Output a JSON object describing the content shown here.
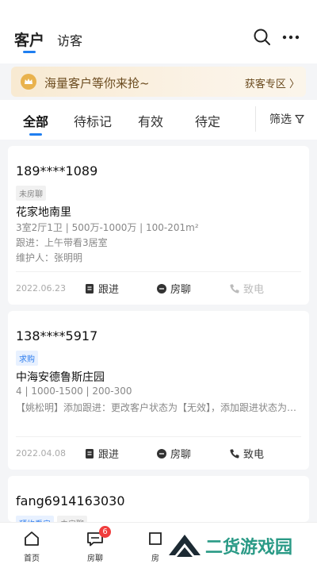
{
  "header": {
    "tabs": [
      {
        "label": "客户",
        "active": true
      },
      {
        "label": "访客",
        "active": false
      }
    ],
    "icons": [
      "search-icon",
      "more-icon"
    ]
  },
  "banner": {
    "text": "海量客户等你来抢~",
    "link": "获客专区"
  },
  "filter": {
    "tabs": [
      {
        "label": "全部",
        "active": true
      },
      {
        "label": "待标记",
        "active": false
      },
      {
        "label": "有效",
        "active": false
      },
      {
        "label": "待定",
        "active": false
      }
    ],
    "button": "筛选"
  },
  "customers": [
    {
      "phone": "189****1089",
      "tags": [
        {
          "label": "未房聊",
          "style": "gray"
        }
      ],
      "estate": "花家地南里",
      "spec": "3室2厅1卫 | 500万-1000万 | 100-201m²",
      "followup": "跟进：上午带看3居室",
      "maintainer": "维护人：张明明",
      "date": "2022.06.23",
      "actions": {
        "follow": "跟进",
        "chat": "房聊",
        "call": "致电"
      },
      "call_enabled": false
    },
    {
      "phone": "138****5917",
      "tags": [
        {
          "label": "求购",
          "style": "blue"
        }
      ],
      "estate": "中海安德鲁斯庄园",
      "spec": "4 | 1000-1500 | 200-300",
      "followup": "【姚松明】添加跟进：更改客户状态为【无效】，添加跟进状态为…",
      "date": "2022.04.08",
      "actions": {
        "follow": "跟进",
        "chat": "房聊",
        "call": "致电"
      },
      "call_enabled": true
    },
    {
      "phone": "fang6914163030",
      "tags": [
        {
          "label": "预约看房",
          "style": "blue"
        },
        {
          "label": "未房聊",
          "style": "gray"
        }
      ]
    }
  ],
  "bottom_nav": [
    {
      "label": "首页",
      "icon": "home-icon"
    },
    {
      "label": "房聊",
      "icon": "chat-icon",
      "badge": "6"
    },
    {
      "label": "房",
      "icon": "house-icon"
    }
  ],
  "watermark": {
    "text": "二货游戏园"
  },
  "colors": {
    "accent": "#1f7ef0",
    "badge": "#f03d3d",
    "banner_text": "#6b4b1f"
  }
}
